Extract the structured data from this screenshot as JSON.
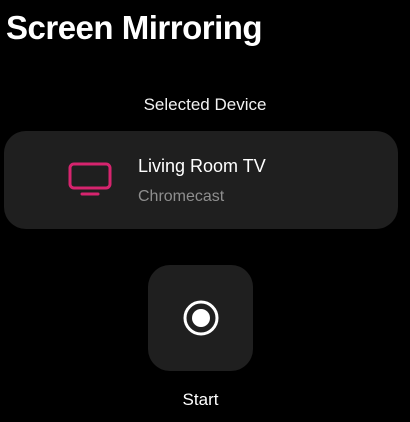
{
  "header": {
    "title": "Screen Mirroring"
  },
  "selected_device": {
    "section_label": "Selected Device",
    "name": "Living Room TV",
    "type": "Chromecast",
    "icon": "tv-icon",
    "icon_color": "#d6246e"
  },
  "start": {
    "label": "Start",
    "icon": "record-icon"
  },
  "colors": {
    "background": "#000000",
    "card": "#1f1f1f",
    "secondary_text": "#8e8e8e"
  }
}
